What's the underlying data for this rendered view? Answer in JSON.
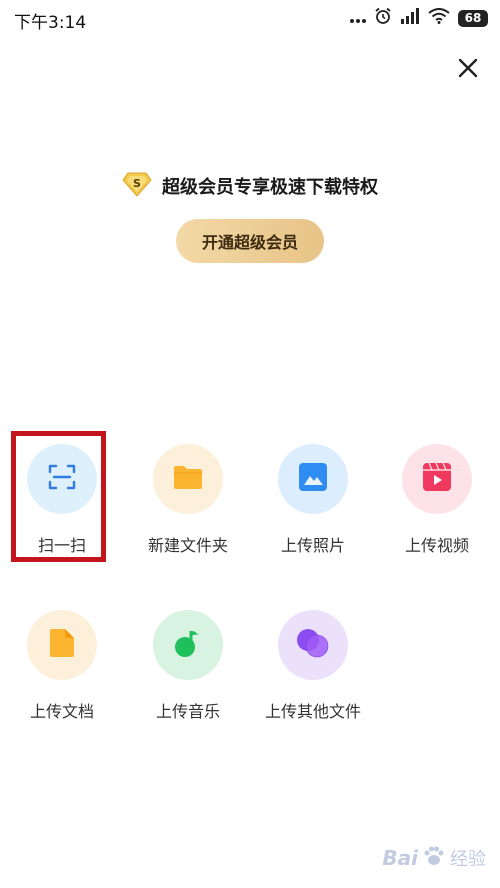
{
  "status_bar": {
    "time": "下午3:14",
    "battery": "68",
    "icons": [
      "more-dots-icon",
      "alarm-icon",
      "signal-icon",
      "wifi-icon",
      "battery-icon"
    ]
  },
  "close_icon": "close-icon",
  "vip": {
    "badge_letter": "S",
    "banner_text": "超级会员专享极速下载特权",
    "button_label": "开通超级会员"
  },
  "actions": [
    {
      "label": "扫一扫",
      "icon": "scan-icon",
      "bg": "#dff0fd",
      "color": "#2f7de1"
    },
    {
      "label": "新建文件夹",
      "icon": "folder-icon",
      "bg": "#fdf0da",
      "color": "#fbb430"
    },
    {
      "label": "上传照片",
      "icon": "photo-icon",
      "bg": "#dcedfd",
      "color": "#2f8cf0"
    },
    {
      "label": "上传视频",
      "icon": "video-icon",
      "bg": "#fde3e8",
      "color": "#f0395f"
    },
    {
      "label": "上传文档",
      "icon": "document-icon",
      "bg": "#fdf0da",
      "color": "#fbb430"
    },
    {
      "label": "上传音乐",
      "icon": "music-icon",
      "bg": "#d8f3e2",
      "color": "#1fbf5b"
    },
    {
      "label": "上传其他文件",
      "icon": "other-files-icon",
      "bg": "#ece1fb",
      "color": "#8b4cf0"
    }
  ],
  "watermark": {
    "brand_prefix": "Bai",
    "brand_suffix": "经验",
    "icon": "paw-icon"
  }
}
